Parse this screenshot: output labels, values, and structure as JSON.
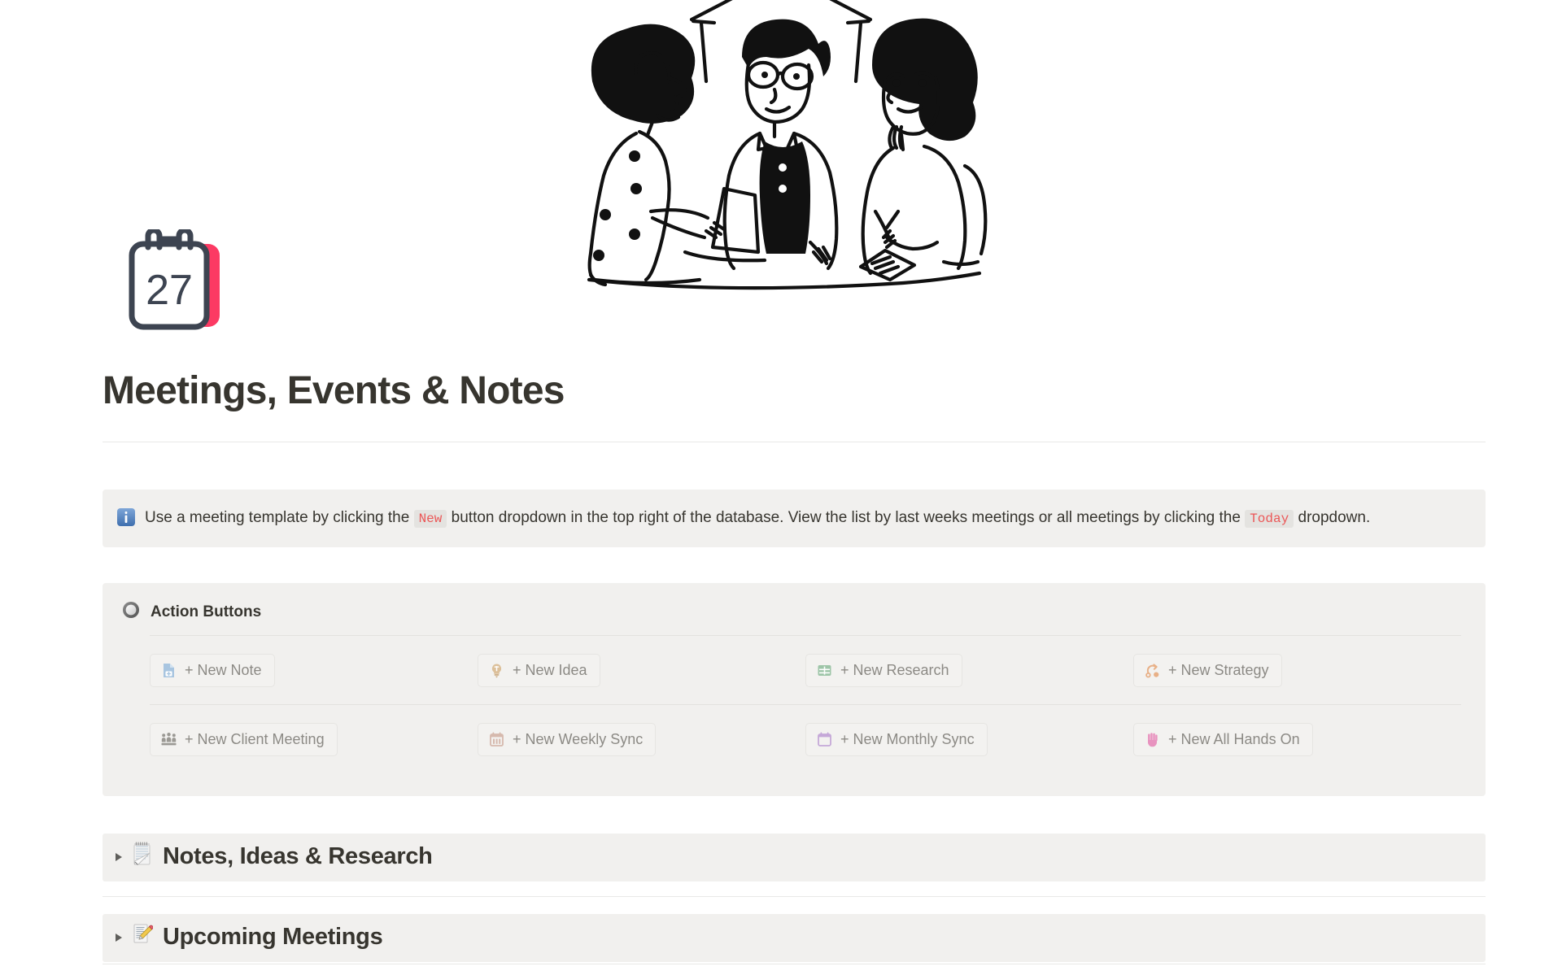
{
  "page": {
    "title": "Meetings, Events & Notes",
    "page_icon": "calendar-27-icon",
    "cover_illustration": "three-people-meeting-at-table-line-drawing"
  },
  "callout": {
    "icon": "information-source-emoji",
    "text_part_1": "Use a meeting template by clicking the",
    "code_1": "New",
    "text_part_2": "button dropdown in the top right of the database. View the list by last weeks meetings or all meetings by clicking the",
    "code_2": "Today",
    "text_part_3": "dropdown.",
    "code_color": "#eb5757",
    "background": "#f1f0ee"
  },
  "action_section": {
    "icon": "radio-button-emoji",
    "title": "Action Buttons",
    "rows": [
      [
        {
          "label": "+ New Note",
          "icon": "page-with-plus-icon",
          "icon_color": "#a8c5e0"
        },
        {
          "label": "+ New Idea",
          "icon": "lightbulb-icon",
          "icon_color": "#dcc09a"
        },
        {
          "label": "+ New Research",
          "icon": "table-grid-icon",
          "icon_color": "#9ec5a8"
        },
        {
          "label": "+ New Strategy",
          "icon": "strategy-arrow-icon",
          "icon_color": "#e8b087"
        }
      ],
      [
        {
          "label": "+ New Client Meeting",
          "icon": "people-meeting-icon",
          "icon_color": "#9b9994"
        },
        {
          "label": "+ New Weekly Sync",
          "icon": "calendar-week-icon",
          "icon_color": "#d6b9ad"
        },
        {
          "label": "+ New Monthly Sync",
          "icon": "calendar-month-icon",
          "icon_color": "#c5a8d8"
        },
        {
          "label": "+ New All Hands On",
          "icon": "raised-hand-icon",
          "icon_color": "#e893bf"
        }
      ]
    ]
  },
  "toggles": [
    {
      "icon": "notepad-emoji",
      "label": "Notes, Ideas & Research"
    },
    {
      "icon": "memo-emoji",
      "label": "Upcoming Meetings"
    }
  ],
  "colors": {
    "text": "#37352f",
    "muted": "#8c8a85",
    "panel": "#f1f0ee",
    "divider": "#e9e9e7"
  }
}
